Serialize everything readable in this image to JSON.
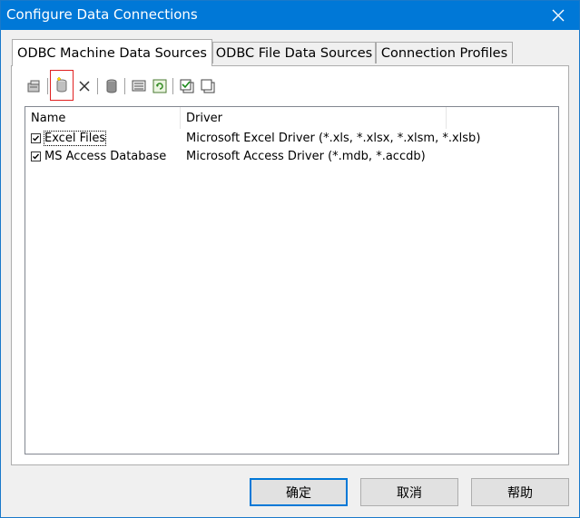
{
  "window": {
    "title": "Configure Data Connections"
  },
  "tabs": [
    {
      "label": "ODBC Machine Data Sources",
      "active": true
    },
    {
      "label": "ODBC File Data Sources",
      "active": false
    },
    {
      "label": "Connection Profiles",
      "active": false
    }
  ],
  "toolbar": {
    "icons": [
      "properties-icon",
      "new-data-source-icon",
      "delete-icon",
      "database-icon",
      "configure-icon",
      "refresh-icon",
      "check-all-icon",
      "uncheck-all-icon"
    ]
  },
  "list": {
    "columns": [
      "Name",
      "Driver"
    ],
    "rows": [
      {
        "name": "Excel Files",
        "driver": "Microsoft Excel Driver (*.xls, *.xlsx, *.xlsm, *.xlsb)",
        "checked": true
      },
      {
        "name": "MS Access Database",
        "driver": "Microsoft Access Driver (*.mdb, *.accdb)",
        "checked": true
      }
    ]
  },
  "buttons": {
    "ok": "确定",
    "cancel": "取消",
    "help": "帮助"
  },
  "colors": {
    "titlebar": "#0078d7",
    "accent": "#0078d7",
    "highlight_border": "#e02020"
  }
}
